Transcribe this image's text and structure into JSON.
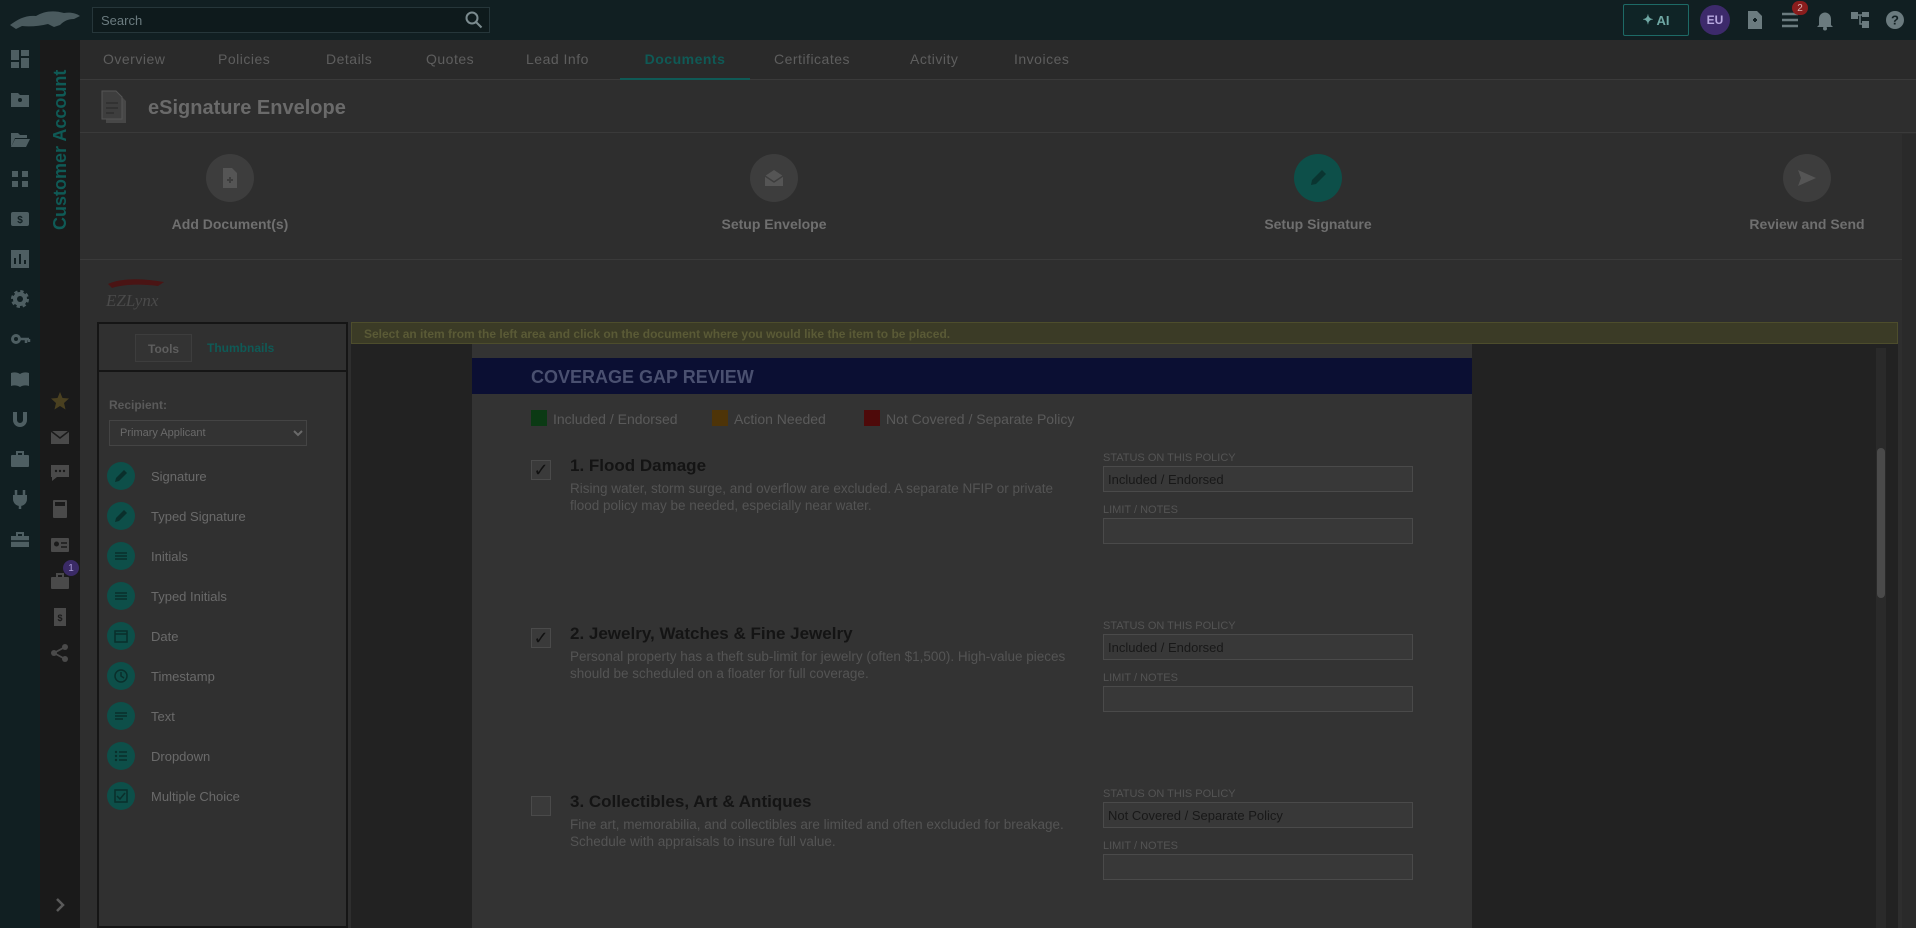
{
  "search": {
    "placeholder": "Search"
  },
  "topbar": {
    "ai_label": "AI",
    "avatar_initials": "EU",
    "notification_count": "2"
  },
  "side_title": "Customer Account",
  "side_badge": "1",
  "tabs": [
    {
      "label": "Overview"
    },
    {
      "label": "Policies"
    },
    {
      "label": "Details"
    },
    {
      "label": "Quotes"
    },
    {
      "label": "Lead Info"
    },
    {
      "label": "Documents"
    },
    {
      "label": "Certificates"
    },
    {
      "label": "Activity"
    },
    {
      "label": "Invoices"
    }
  ],
  "page_title": "eSignature Envelope",
  "steps": [
    {
      "label": "Add Document(s)"
    },
    {
      "label": "Setup Envelope"
    },
    {
      "label": "Setup Signature"
    },
    {
      "label": "Review and Send"
    }
  ],
  "tools_panel": {
    "tab_tools": "Tools",
    "tab_thumbnails": "Thumbnails",
    "recipient_label": "Recipient:",
    "recipient_value": "Primary Applicant",
    "items": [
      {
        "label": "Signature"
      },
      {
        "label": "Typed Signature"
      },
      {
        "label": "Initials"
      },
      {
        "label": "Typed Initials"
      },
      {
        "label": "Date"
      },
      {
        "label": "Timestamp"
      },
      {
        "label": "Text"
      },
      {
        "label": "Dropdown"
      },
      {
        "label": "Multiple Choice"
      }
    ]
  },
  "instruction": "Select an item from the left area and click on the document where you would like the item to be placed.",
  "document": {
    "title": "COVERAGE GAP REVIEW",
    "legend": [
      {
        "label": "Included / Endorsed",
        "color": "#0b3a14"
      },
      {
        "label": "Action Needed",
        "color": "#4e3408"
      },
      {
        "label": "Not Covered / Separate Policy",
        "color": "#4e0a0a"
      }
    ],
    "status_label": "STATUS ON THIS POLICY",
    "limit_label": "LIMIT / NOTES",
    "items": [
      {
        "title": "1. Flood Damage",
        "checked": "✓",
        "desc": "Rising water, storm surge, and overflow are excluded. A separate NFIP or private flood policy may be needed, especially near water.",
        "status": "Included / Endorsed"
      },
      {
        "title": "2. Jewelry, Watches & Fine Jewelry",
        "checked": "✓",
        "desc": "Personal property has a theft sub-limit for jewelry (often $1,500). High-value pieces should be scheduled on a floater for full coverage.",
        "status": "Included / Endorsed"
      },
      {
        "title": "3. Collectibles, Art & Antiques",
        "checked": "",
        "desc": "Fine art, memorabilia, and collectibles are limited and often excluded for breakage. Schedule with appraisals to insure full value.",
        "status": "Not Covered / Separate Policy"
      }
    ]
  }
}
